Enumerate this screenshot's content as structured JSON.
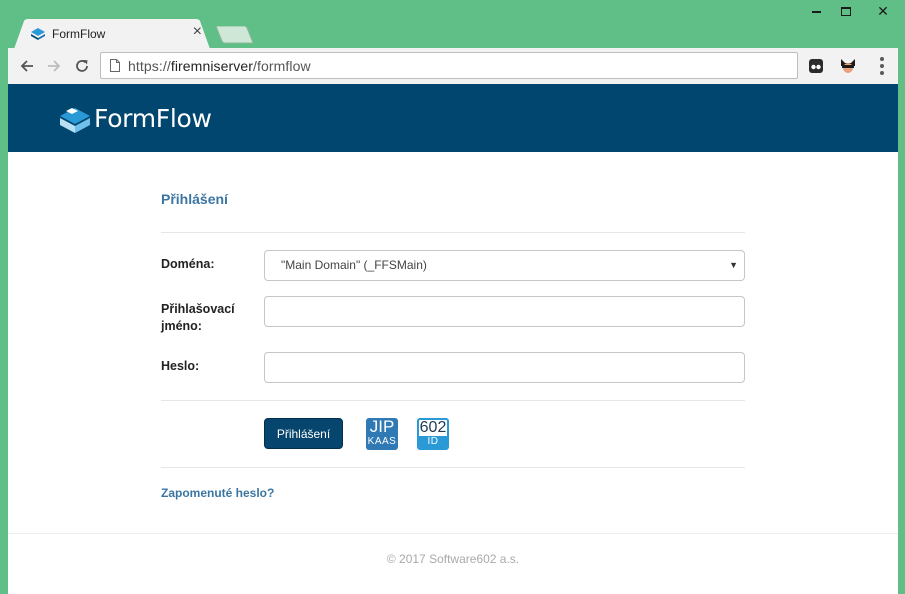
{
  "browser": {
    "tab_title": "FormFlow",
    "tab_close": "×",
    "url_scheme": "https://",
    "url_host": "firemniserver",
    "url_path": "/formflow",
    "icons": [
      "back-arrow-icon",
      "forward-arrow-icon",
      "reload-icon",
      "page-icon",
      "ghostery-icon",
      "incognito-icon",
      "menu-icon"
    ]
  },
  "window": {
    "close_glyph": "✕"
  },
  "header": {
    "brand": "FormFlow",
    "background": "#00466e"
  },
  "login": {
    "title": "Přihlášení",
    "domain_label": "Doména:",
    "domain_value": "\"Main Domain\" (_FFSMain)",
    "username_label_1": "Přihlašovací",
    "username_label_2": "jméno:",
    "username_value": "",
    "password_label": "Heslo:",
    "password_value": "",
    "submit_label": "Přihlášení",
    "jip_top": "JIP",
    "jip_bottom": "KAAS",
    "id602_top": "602",
    "id602_bottom": "ID",
    "forgot_link": "Zapomenuté heslo?"
  },
  "footer": {
    "copyright": "© 2017 Software602 a.s."
  },
  "colors": {
    "accent": "#3b76a2",
    "window_frame": "#5fbf86",
    "button": "#06456d"
  }
}
